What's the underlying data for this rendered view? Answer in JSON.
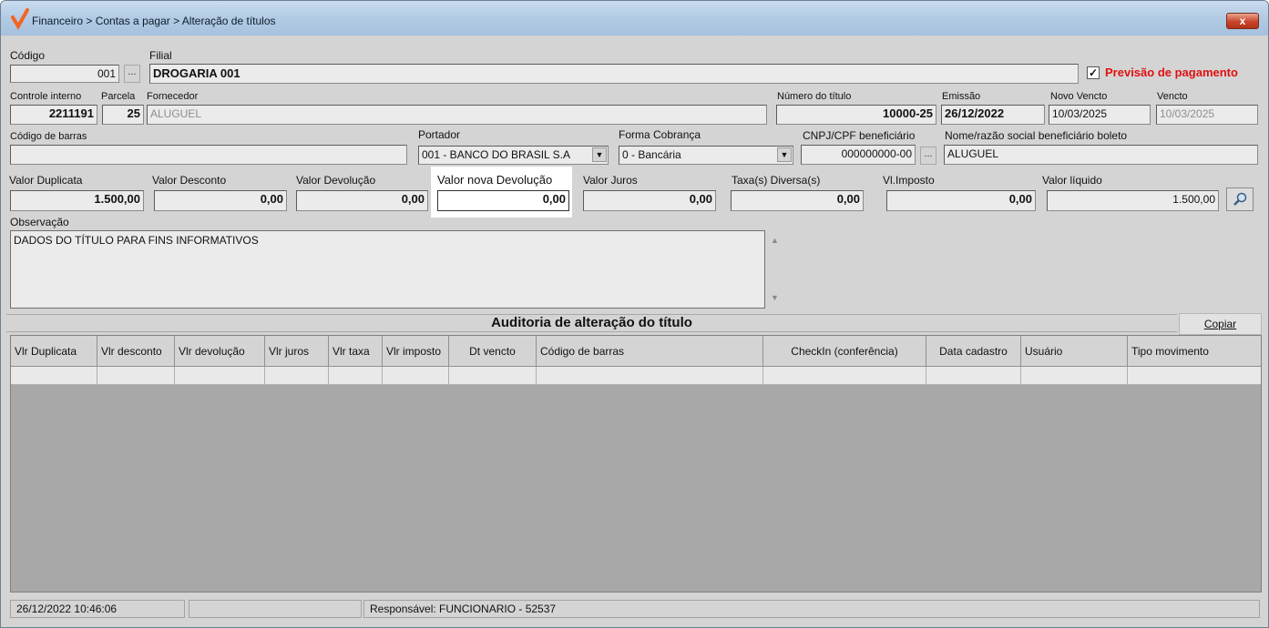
{
  "window": {
    "title": "Financeiro > Contas a pagar > Alteração de títulos",
    "close_label": "x"
  },
  "form": {
    "codigo": {
      "label": "Código",
      "value": "001"
    },
    "filial": {
      "label": "Filial",
      "value": "DROGARIA 001"
    },
    "previsao": {
      "label": "Previsão de pagamento",
      "checked": true
    },
    "controle_interno": {
      "label": "Controle interno",
      "value": "2211191"
    },
    "parcela": {
      "label": "Parcela",
      "value": "25"
    },
    "fornecedor": {
      "label": "Fornecedor",
      "value": "ALUGUEL"
    },
    "numero_titulo": {
      "label": "Número do título",
      "value": "10000-25"
    },
    "emissao": {
      "label": "Emissão",
      "value": "26/12/2022"
    },
    "novo_vencto": {
      "label": "Novo Vencto",
      "value": "10/03/2025"
    },
    "vencto": {
      "label": "Vencto",
      "value": "10/03/2025"
    },
    "codigo_barras": {
      "label": "Código de barras",
      "value": ""
    },
    "portador": {
      "label": "Portador",
      "value": "001 - BANCO DO BRASIL S.A"
    },
    "forma_cobranca": {
      "label": "Forma Cobrança",
      "value": "0 - Bancária"
    },
    "cnpj": {
      "label": "CNPJ/CPF beneficiário",
      "value": "000000000-00"
    },
    "nome_beneficiario": {
      "label": "Nome/razão social beneficiário boleto",
      "value": "ALUGUEL"
    },
    "valor_duplicata": {
      "label": "Valor Duplicata",
      "value": "1.500,00"
    },
    "valor_desconto": {
      "label": "Valor Desconto",
      "value": "0,00"
    },
    "valor_devolucao": {
      "label": "Valor Devolução",
      "value": "0,00"
    },
    "valor_nova_devolucao": {
      "label": "Valor nova Devolução",
      "value": "0,00"
    },
    "valor_juros": {
      "label": "Valor Juros",
      "value": "0,00"
    },
    "taxas_diversas": {
      "label": "Taxa(s) Diversa(s)",
      "value": "0,00"
    },
    "vl_imposto": {
      "label": "Vl.Imposto",
      "value": "0,00"
    },
    "valor_liquido": {
      "label": "Valor líquido",
      "value": "1.500,00"
    },
    "observacao": {
      "label": "Observação",
      "value": "DADOS DO TÍTULO PARA FINS INFORMATIVOS"
    }
  },
  "audit": {
    "title": "Auditoria de alteração do título",
    "copy_label": "Copiar",
    "columns": [
      "Vlr Duplicata",
      "Vlr desconto",
      "Vlr devolução",
      "Vlr juros",
      "Vlr taxa",
      "Vlr imposto",
      "Dt vencto",
      "Código de barras",
      "CheckIn (conferência)",
      "Data cadastro",
      "Usuário",
      "Tipo movimento"
    ]
  },
  "status": {
    "datetime": "26/12/2022 10:46:06",
    "middle": "",
    "responsavel": "Responsável: FUNCIONARIO - 52537"
  },
  "colors": {
    "accent_red": "#e01010",
    "logo_orange": "#f26522"
  },
  "icons": [
    "logo-icon",
    "close-icon",
    "checkbox-checked-icon",
    "dropdown-arrow-icon",
    "search-icon",
    "scroll-up-icon",
    "scroll-down-icon"
  ]
}
